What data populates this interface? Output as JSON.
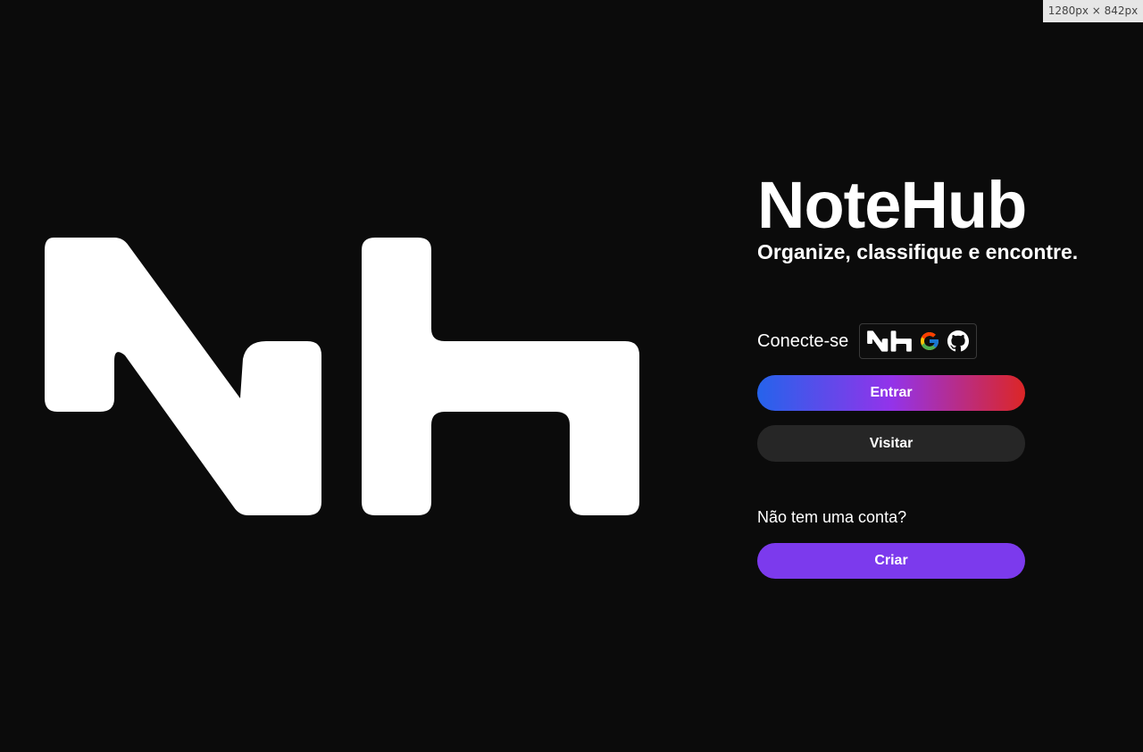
{
  "viewport_badge": "1280px × 842px",
  "branding": {
    "logo": "NoteHub logo (Nh)",
    "title": "NoteHub",
    "tagline": "Organize, classifique e encontre."
  },
  "login": {
    "connect_label": "Conecte-se",
    "providers": [
      {
        "name": "NoteHub",
        "icon": "notehub-icon"
      },
      {
        "name": "Google",
        "icon": "google-icon"
      },
      {
        "name": "GitHub",
        "icon": "github-icon"
      }
    ],
    "enter_label": "Entrar",
    "visit_label": "Visitar",
    "no_account_text": "Não tem uma conta?",
    "create_label": "Criar"
  },
  "colors": {
    "background": "#0b0b0b",
    "enter_gradient": [
      "#2563eb",
      "#9333ea",
      "#dc2626"
    ],
    "visit_button": "#262626",
    "create_button": "#7c3aed"
  }
}
